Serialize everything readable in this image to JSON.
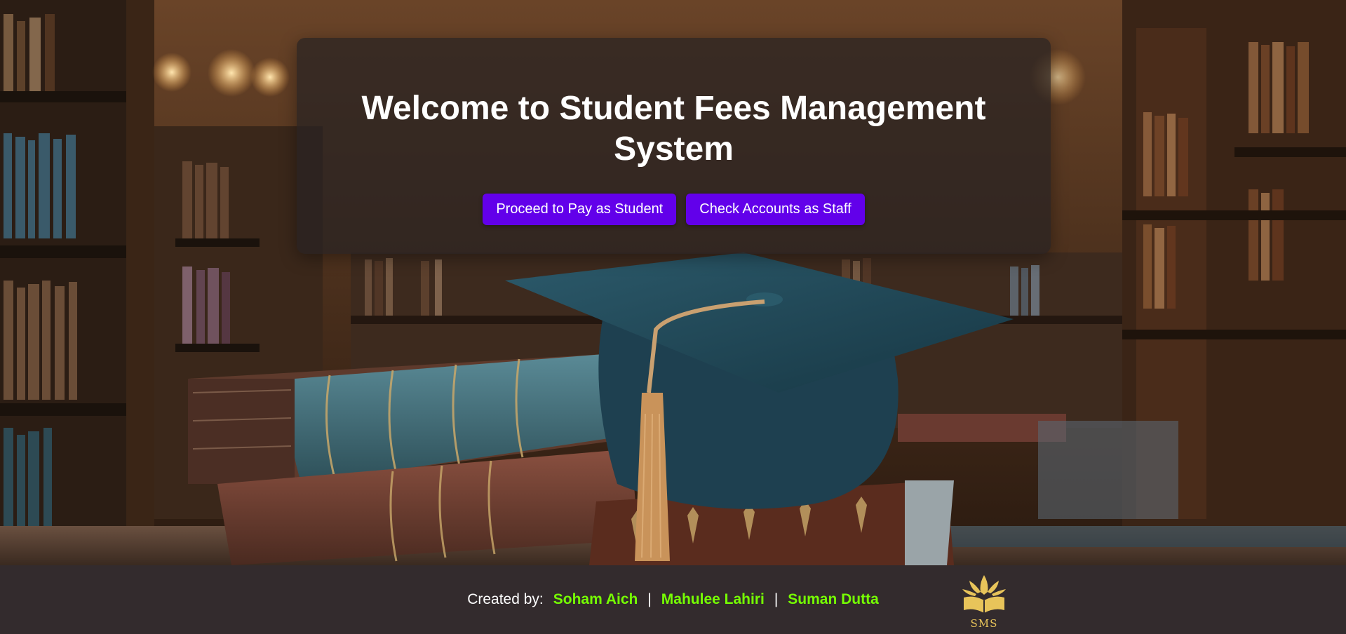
{
  "hero": {
    "title": "Welcome to Student Fees Management System",
    "buttons": {
      "student_label": "Proceed to Pay as Student",
      "staff_label": "Check Accounts as Staff"
    }
  },
  "footer": {
    "created_by_label": "Created by:",
    "authors": [
      "Soham Aich",
      "Mahulee Lahiri",
      "Suman Dutta"
    ],
    "separator": "|",
    "logo_text": "SMS"
  },
  "colors": {
    "button_bg": "#6200ea",
    "author_text": "#76ff03",
    "footer_bg": "#332b2d",
    "logo_gold": "#e8c45a"
  },
  "icons": {
    "logo": "open-book-crown-logo-icon"
  }
}
